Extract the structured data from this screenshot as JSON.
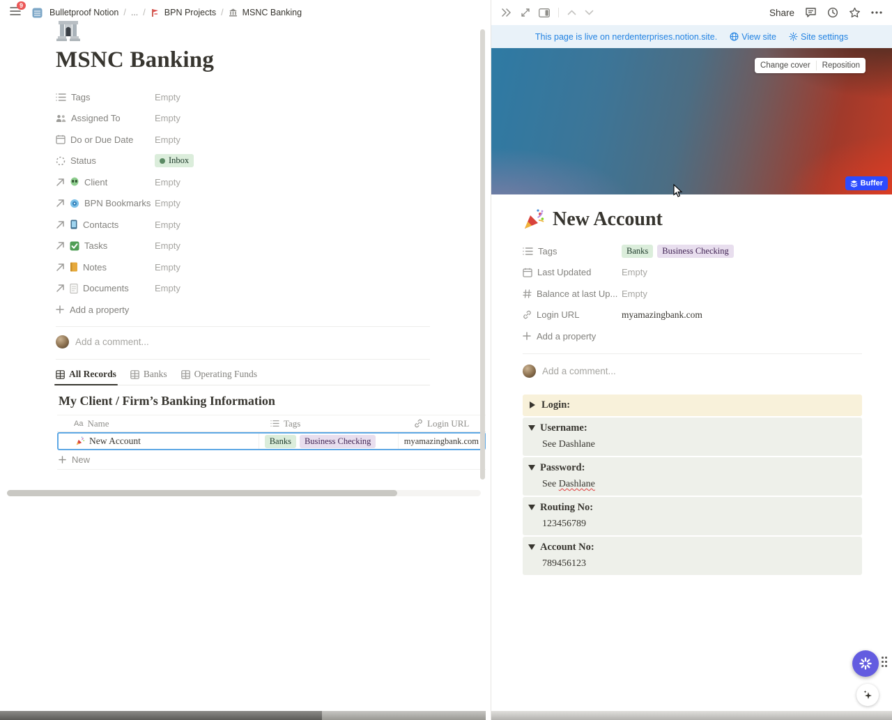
{
  "topbar_left": {
    "badge": "9",
    "workspace_name": "Bulletproof Notion",
    "crumb_sep": "/",
    "crumb_ellipsis": "...",
    "crumb_projects": "BPN Projects",
    "crumb_page": "MSNC Banking"
  },
  "topbar_right": {
    "share": "Share"
  },
  "left": {
    "title": "MSNC Banking",
    "properties": [
      {
        "name": "Tags",
        "value": "Empty"
      },
      {
        "name": "Assigned To",
        "value": "Empty"
      },
      {
        "name": "Do or Due Date",
        "value": "Empty"
      },
      {
        "name": "Status",
        "value": "Inbox"
      },
      {
        "name": "Client",
        "value": "Empty"
      },
      {
        "name": "BPN Bookmarks",
        "value": "Empty"
      },
      {
        "name": "Contacts",
        "value": "Empty"
      },
      {
        "name": "Tasks",
        "value": "Empty"
      },
      {
        "name": "Notes",
        "value": "Empty"
      },
      {
        "name": "Documents",
        "value": "Empty"
      }
    ],
    "add_property": "Add a property",
    "comment_placeholder": "Add a comment...",
    "tabs": [
      {
        "label": "All Records"
      },
      {
        "label": "Banks"
      },
      {
        "label": "Operating Funds"
      }
    ],
    "section_title": "My Client / Firm’s Banking Information",
    "table": {
      "col_name_icon": "Aa",
      "col_name": "Name",
      "col_tags": "Tags",
      "col_url": "Login URL",
      "row": {
        "name": "New Account",
        "tag1": "Banks",
        "tag2": "Business Checking",
        "url": "myamazingbank.com"
      },
      "new_label": "New"
    }
  },
  "right": {
    "banner": {
      "message": "This page is live on nerdenterprises.notion.site.",
      "view_site": "View site",
      "site_settings": "Site settings"
    },
    "cover": {
      "change_cover": "Change cover",
      "reposition": "Reposition",
      "buffer_label": "Buffer"
    },
    "title": "New Account",
    "properties": [
      {
        "name": "Tags",
        "tag1": "Banks",
        "tag2": "Business Checking"
      },
      {
        "name": "Last Updated",
        "value": "Empty"
      },
      {
        "name": "Balance at last Up...",
        "value": "Empty"
      },
      {
        "name": "Login URL",
        "value": "myamazingbank.com"
      }
    ],
    "add_property": "Add a property",
    "comment_placeholder": "Add a comment...",
    "toggles": [
      {
        "label": "Login:"
      },
      {
        "label": "Username:",
        "content": "See Dashlane"
      },
      {
        "label": "Password:",
        "content_prefix": "See ",
        "content_word": "Dashlane"
      },
      {
        "label": "Routing No:",
        "content": "123456789"
      },
      {
        "label": "Account No:",
        "content": "789456123"
      }
    ]
  },
  "colors": {
    "accent_blue": "#2383e2",
    "green_tag_bg": "#dbeddb",
    "purple_tag_bg": "#e8deee",
    "status_dot": "#5b8a64",
    "yellow_block_bg": "#f8f1da",
    "gray_block_bg": "#eef0ea",
    "buffer_blue": "#2c4bff",
    "ai_purple": "#635ce0",
    "cover_red": "#c03d27",
    "cover_blue": "#2e7aa4"
  }
}
